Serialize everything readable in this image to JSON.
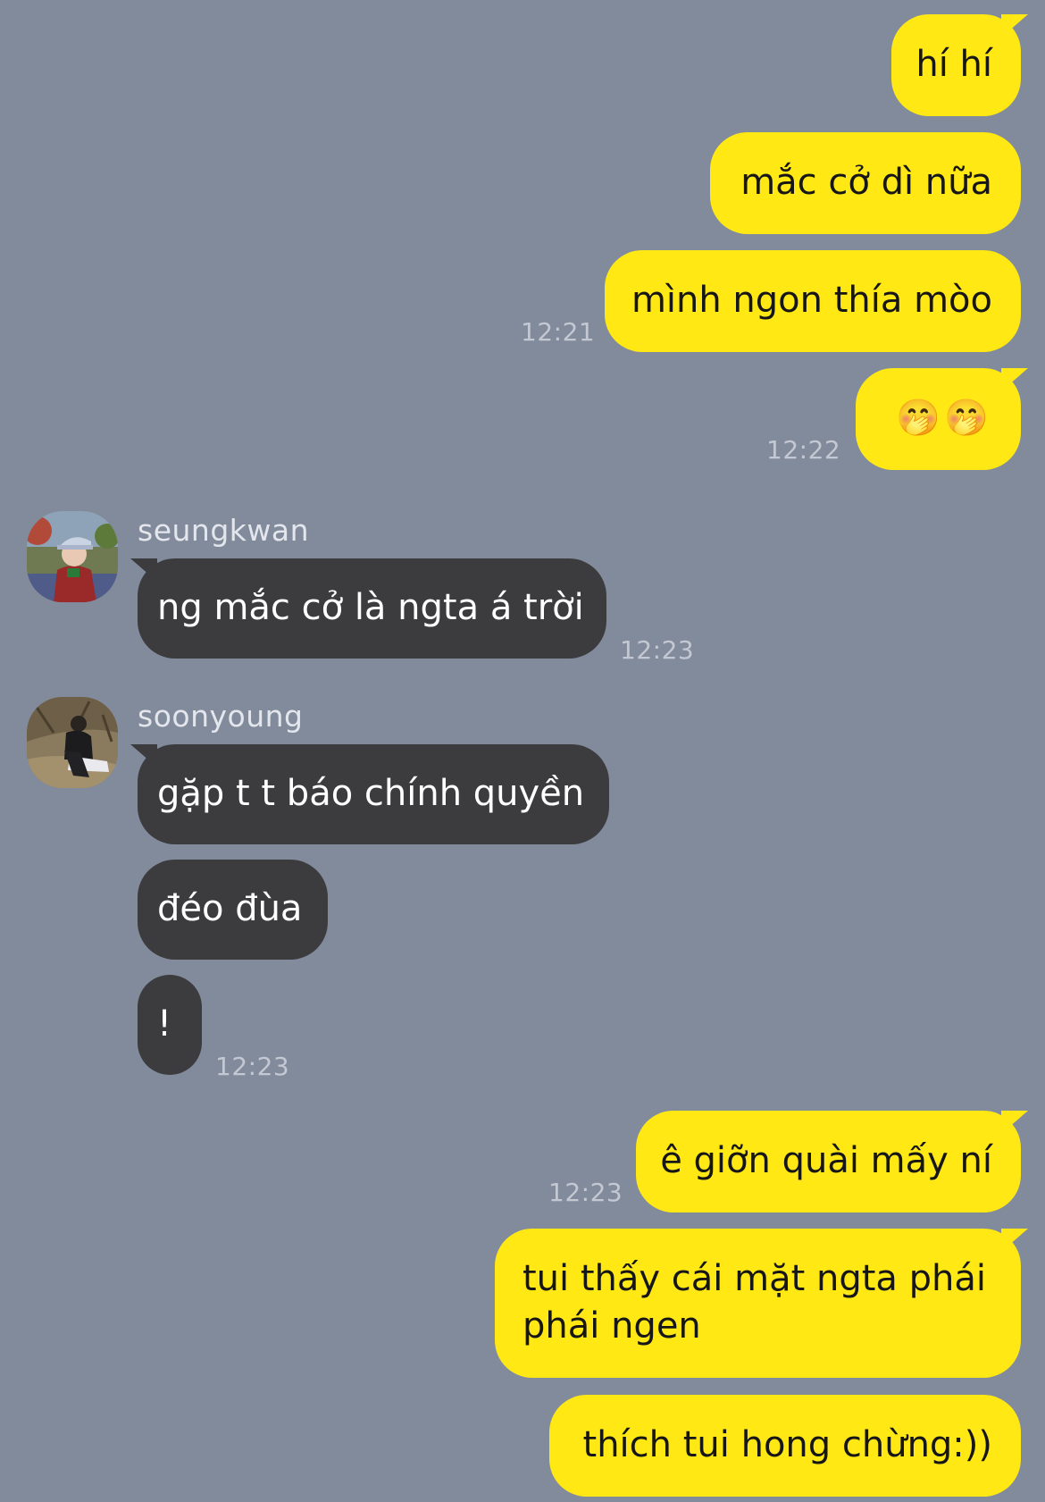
{
  "messages": {
    "m1": "hí hí",
    "m2": "mắc cở dì nữa",
    "m3": "mình ngon thía mòo",
    "m4": "🤭🤭",
    "m5": "ng mắc cở là ngta á trời",
    "m6": "gặp t t báo chính quyền",
    "m7": "đéo đùa",
    "m8": "!",
    "m9": "ê giỡn quài mấy ní",
    "m10_line1": "tui thấy cái mặt ngta phái",
    "m10_line2": "phái ngen",
    "m11": "thích tui hong chừng:))"
  },
  "times": {
    "t1": "12:21",
    "t2": "12:22",
    "t3": "12:23",
    "t4": "12:23",
    "t5": "12:23"
  },
  "senders": {
    "s1": "seungkwan",
    "s2": "soonyoung"
  },
  "colors": {
    "background": "#828b9b",
    "my_bubble": "#ffe813",
    "their_bubble": "#3c3c3e"
  }
}
